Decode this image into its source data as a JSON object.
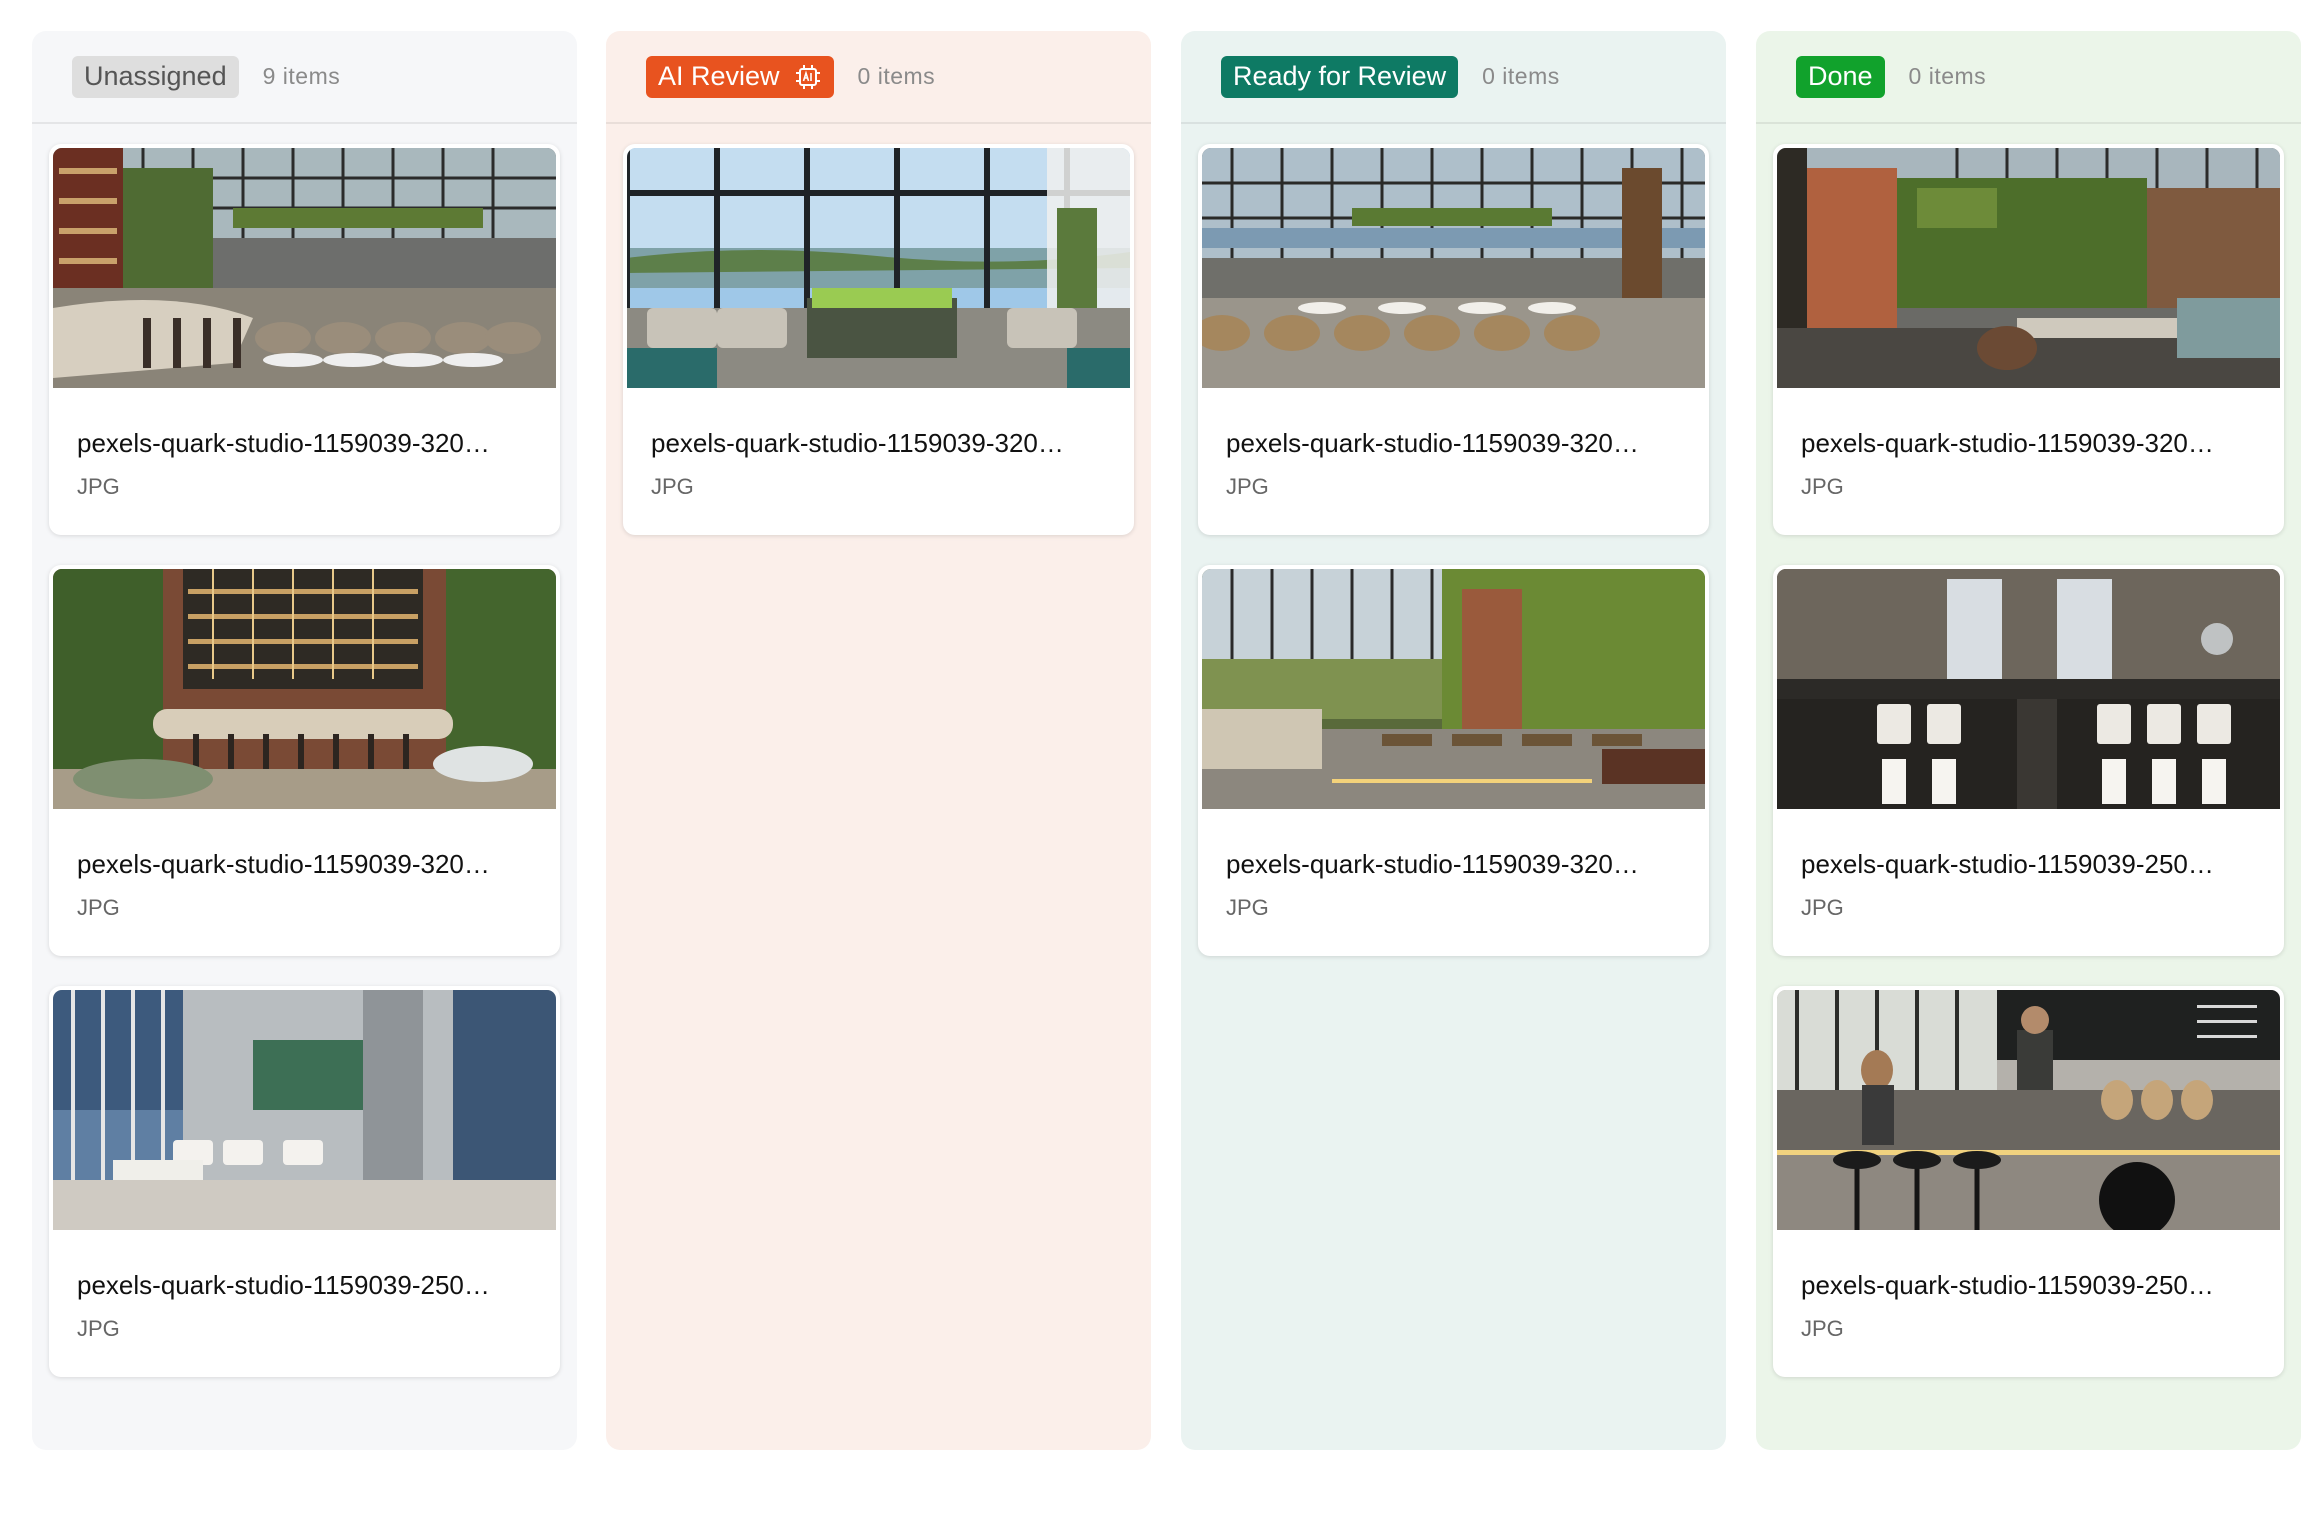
{
  "columns": [
    {
      "status": "Unassigned",
      "count_label": "9 items",
      "badge_bg": "#dedede",
      "badge_color": "#555555",
      "column_bg": "#f6f7f9",
      "cards": [
        {
          "title": "pexels-quark-studio-1159039-320…",
          "type": "JPG",
          "scene": "restaurant-bar-wall"
        },
        {
          "title": "pexels-quark-studio-1159039-320…",
          "type": "JPG",
          "scene": "brick-bar-greenery"
        },
        {
          "title": "pexels-quark-studio-1159039-250…",
          "type": "JPG",
          "scene": "high-rise-lounge"
        }
      ]
    },
    {
      "status": "AI Review",
      "count_label": "0 items",
      "badge_bg": "#e8531f",
      "badge_color": "#ffffff",
      "column_bg": "#fbefea",
      "icon": "ai-chip-icon",
      "cards": [
        {
          "title": "pexels-quark-studio-1159039-320…",
          "type": "JPG",
          "scene": "lakeview-lounge"
        }
      ]
    },
    {
      "status": "Ready for Review",
      "count_label": "0 items",
      "badge_bg": "#0e7a64",
      "badge_color": "#ffffff",
      "column_bg": "#eaf3f1",
      "cards": [
        {
          "title": "pexels-quark-studio-1159039-320…",
          "type": "JPG",
          "scene": "glass-dining-hall"
        },
        {
          "title": "pexels-quark-studio-1159039-320…",
          "type": "JPG",
          "scene": "greenhouse-dining"
        }
      ]
    },
    {
      "status": "Done",
      "count_label": "0 items",
      "badge_bg": "#11a22c",
      "badge_color": "#ffffff",
      "column_bg": "#ebf5e9",
      "cards": [
        {
          "title": "pexels-quark-studio-1159039-320…",
          "type": "JPG",
          "scene": "atrium-green-wall"
        },
        {
          "title": "pexels-quark-studio-1159039-250…",
          "type": "JPG",
          "scene": "dark-bathroom-vanity"
        },
        {
          "title": "pexels-quark-studio-1159039-250…",
          "type": "JPG",
          "scene": "cafe-counter"
        }
      ]
    }
  ]
}
